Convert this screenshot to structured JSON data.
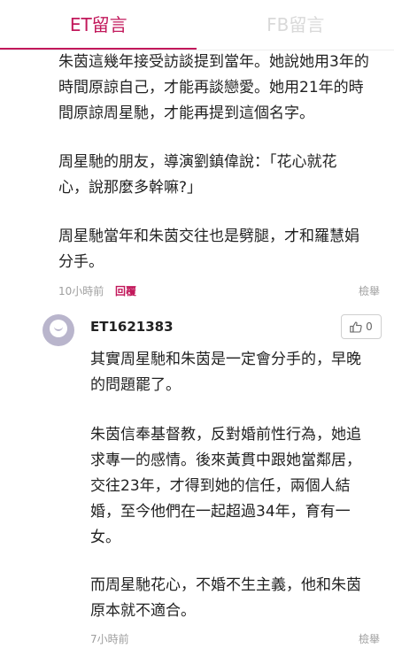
{
  "tabs": [
    {
      "label": "ET留言",
      "active": true
    },
    {
      "label": "FB留言",
      "active": false
    }
  ],
  "comment1": {
    "paragraphs": [
      [
        "朱茵這幾年接受訪談提到當年。她說她用3年的",
        "時間原諒自己，才能再談戀愛。她用21年的時",
        "間原諒周星馳，才能再提到這個名字。"
      ],
      [
        "周星馳的朋友，導演劉鎮偉說：「花心就花",
        "心，說那麼多幹嘛?」"
      ],
      [
        "周星馳當年和朱茵交往也是劈腿，才和羅慧娟",
        "分手。"
      ]
    ],
    "time": "10小時前",
    "reply_label": "回覆",
    "report_label": "檢舉"
  },
  "comment2": {
    "username": "ET1621383",
    "likes": "0",
    "paragraphs": [
      [
        "其實周星馳和朱茵是一定會分手的，早晚",
        "的問題罷了。"
      ],
      [
        "朱茵信奉基督教，反對婚前性行為，她追",
        "求專一的感情。後來黃貫中跟她當鄰居，",
        "交往23年，才得到她的信任，兩個人結",
        "婚，至今他們在一起超過34年，育有一",
        "女。"
      ],
      [
        "而周星馳花心，不婚不生主義，他和朱茵",
        "原本就不適合。"
      ]
    ],
    "time": "7小時前",
    "report_label": "檢舉"
  },
  "colors": {
    "accent": "#c2185b",
    "inactive_tab": "#d9d9d9",
    "meta_text": "#9e9e9e",
    "avatar": "#b9b5cc"
  }
}
